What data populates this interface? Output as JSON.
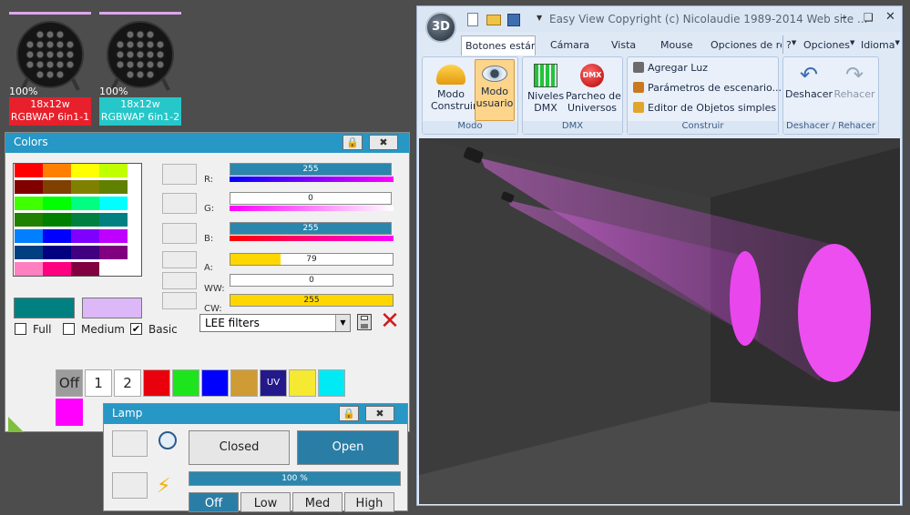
{
  "fixtures": [
    {
      "percent": "100%",
      "line1": "18x12w",
      "line2": "RGBWAP 6in1-1",
      "color": "#e8202c"
    },
    {
      "percent": "100%",
      "line1": "18x12w",
      "line2": "RGBWAP 6in1-2",
      "color": "#25c7c9"
    }
  ],
  "colors_window": {
    "title": "Colors",
    "palette": [
      [
        "#ff0000",
        "#ff8000",
        "#ffff00",
        "#c0ff00"
      ],
      [
        "#800000",
        "#804000",
        "#808000",
        "#608000"
      ],
      [
        "#40ff00",
        "#00ff00",
        "#00ff80",
        "#00ffff"
      ],
      [
        "#208000",
        "#008000",
        "#008040",
        "#008080"
      ],
      [
        "#0080ff",
        "#0000ff",
        "#8000ff",
        "#c000ff"
      ],
      [
        "#004080",
        "#000080",
        "#400080",
        "#800080"
      ],
      [
        "#ff80c0",
        "#ff0080",
        "#800040",
        "#ffffff"
      ]
    ],
    "current_color": "#008080",
    "previous_color": "#dcb8f8",
    "channels": [
      {
        "label": "R:",
        "value": "255",
        "level": 1.0,
        "fill": "#2a86ad",
        "grad": "linear-gradient(90deg,#0000ff,#ff00ff)"
      },
      {
        "label": "G:",
        "value": "0",
        "level": 0.0,
        "fill": "#2a86ad",
        "grad": "linear-gradient(90deg,#ff00ff,#ffffff)"
      },
      {
        "label": "B:",
        "value": "255",
        "level": 1.0,
        "fill": "#2a86ad",
        "grad": "linear-gradient(90deg,#ff0000,#ff00ff)"
      },
      {
        "label": "A:",
        "value": "79",
        "level": 0.31,
        "fill": "#ffd700",
        "grad": ""
      },
      {
        "label": "WW:",
        "value": "0",
        "level": 0.0,
        "fill": "#ffd700",
        "grad": ""
      },
      {
        "label": "CW:",
        "value": "255",
        "level": 1.0,
        "fill": "#ffd700",
        "grad": ""
      }
    ],
    "options": [
      {
        "label": "Full",
        "checked": false
      },
      {
        "label": "Medium",
        "checked": false
      },
      {
        "label": "Basic",
        "checked": true
      }
    ],
    "filter_select": "LEE filters",
    "quick": [
      {
        "label": "Off",
        "bg": "#9c9c9c"
      },
      {
        "label": "1",
        "bg": "#ffffff"
      },
      {
        "label": "2",
        "bg": "#ffffff"
      },
      {
        "label": "",
        "bg": "#e8000c"
      },
      {
        "label": "",
        "bg": "#1ee41e"
      },
      {
        "label": "",
        "bg": "#0000ff"
      },
      {
        "label": "",
        "bg": "#cf9b35"
      },
      {
        "label": "UV",
        "bg": "#24198a"
      },
      {
        "label": "",
        "bg": "#f5e931"
      },
      {
        "label": "",
        "bg": "#00eaf5"
      }
    ],
    "quick_magenta": "#ff00ff"
  },
  "lamp_window": {
    "title": "Lamp",
    "closed": "Closed",
    "open": "Open",
    "level_text": "100 %",
    "level": 1.0,
    "modes": [
      "Off",
      "Low",
      "Med",
      "High"
    ]
  },
  "app": {
    "title": "Easy View  Copyright (c) Nicolaudie 1989-2014   Web site ...",
    "logo": "3D",
    "tabs": [
      "Botones estándar",
      "Cámara",
      "Vista",
      "Mouse",
      "Opciones de re",
      "?",
      "Opciones",
      "Idioma"
    ],
    "groups": {
      "modo": {
        "caption": "Modo",
        "construir": "Modo\nConstruir",
        "usuario": "Modo\nusuario"
      },
      "dmx": {
        "caption": "DMX",
        "niveles": "Niveles\nDMX",
        "parcheo": "Parcheo de\nUniversos",
        "badge": "DMX"
      },
      "construir": {
        "caption": "Construir",
        "items": [
          "Agregar Luz",
          "Parámetros de escenario...",
          "Editor de Objetos simples"
        ]
      },
      "deshacer": {
        "caption": "Deshacer / Rehacer",
        "undo": "Deshacer",
        "redo": "Rehacer"
      }
    }
  }
}
